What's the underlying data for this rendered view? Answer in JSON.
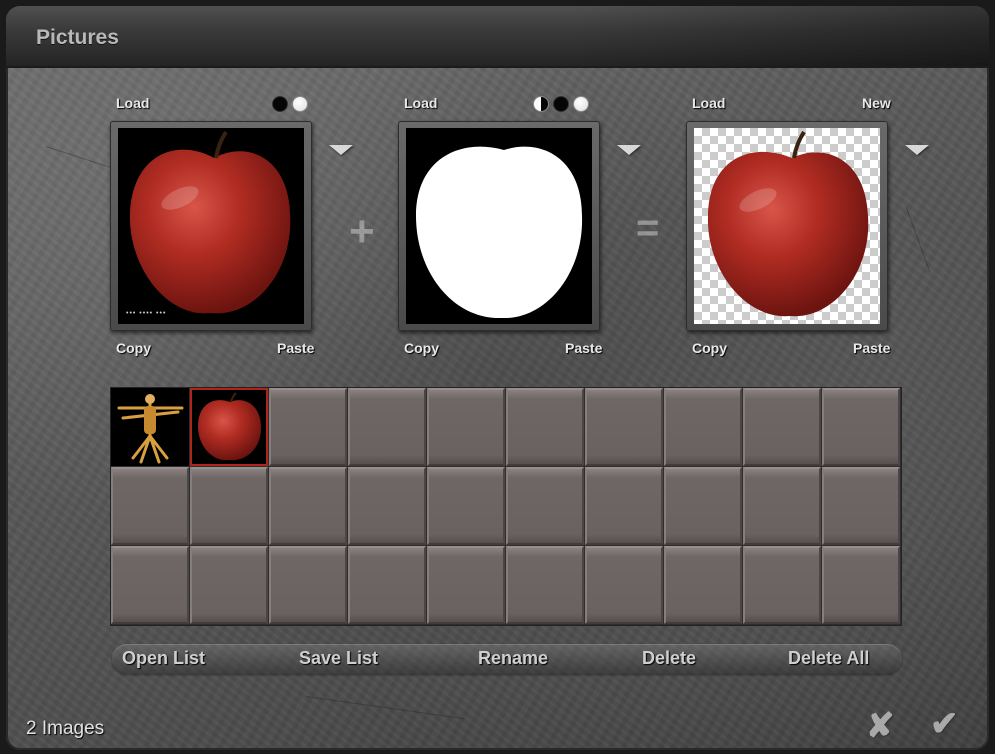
{
  "window": {
    "title": "Pictures"
  },
  "slots": [
    {
      "load": "Load",
      "copy": "Copy",
      "paste": "Paste"
    },
    {
      "load": "Load",
      "copy": "Copy",
      "paste": "Paste"
    },
    {
      "load": "Load",
      "new": "New",
      "copy": "Copy",
      "paste": "Paste"
    }
  ],
  "operators": {
    "plus": "+",
    "equals": "="
  },
  "slot1_caption": "••• •••• •••",
  "grid": {
    "rows": 3,
    "columns": 10,
    "filled": [
      "vitruvian-man-thumbnail",
      "red-apple-thumbnail"
    ]
  },
  "buttons": {
    "open_list": "Open List",
    "save_list": "Save List",
    "rename": "Rename",
    "delete": "Delete",
    "delete_all": "Delete All"
  },
  "status": "2 Images",
  "icons": {
    "cancel": "✘",
    "ok": "✔"
  },
  "colors": {
    "selected_border": "#b0241c",
    "apple_red": "#a8231a"
  }
}
